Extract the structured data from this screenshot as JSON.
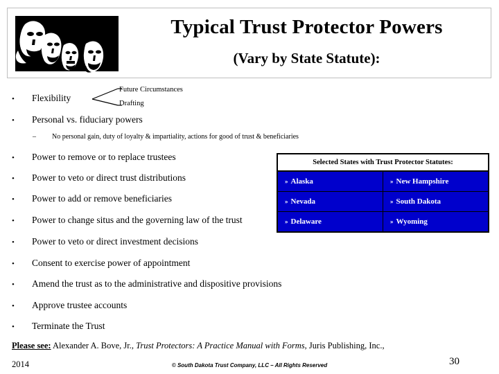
{
  "slide": {
    "title": "Typical Trust Protector Powers",
    "subtitle": "(Vary by State Statute):",
    "header_image_name": "mount-rushmore-graphic"
  },
  "bullets": [
    {
      "marker": "•",
      "text": "Flexibility"
    },
    {
      "marker": "•",
      "text": "Personal vs. fiduciary powers"
    },
    {
      "marker": "•",
      "text": "Power to remove or to replace trustees"
    },
    {
      "marker": "•",
      "text": "Power to veto or direct trust distributions"
    },
    {
      "marker": "•",
      "text": "Power to add or remove beneficiaries"
    },
    {
      "marker": "•",
      "text": "Power to change situs and the governing law of the trust"
    },
    {
      "marker": "•",
      "text": "Power to veto or direct investment decisions"
    },
    {
      "marker": "•",
      "text": "Consent to exercise power of appointment"
    },
    {
      "marker": "•",
      "text": "Amend the trust as to the administrative and dispositive provisions"
    },
    {
      "marker": "•",
      "text": "Approve trustee accounts"
    },
    {
      "marker": "•",
      "text": "Terminate the Trust"
    }
  ],
  "sub_bullet": {
    "marker": "–",
    "text": "No personal gain, duty of loyalty & impartiality, actions for good of trust & beneficiaries"
  },
  "flexibility_branches": {
    "top": "Future Circumstances",
    "bottom": "Drafting"
  },
  "states_table": {
    "header": "Selected States with Trust Protector Statutes:",
    "bullet_glyph": "»",
    "rows": [
      [
        "Alaska",
        "New Hampshire"
      ],
      [
        "Nevada",
        "South Dakota"
      ],
      [
        "Delaware",
        "Wyoming"
      ]
    ]
  },
  "footer": {
    "please_see": "Please see:",
    "citation_pre": " Alexander A. Bove, Jr., ",
    "citation_italic": "Trust Protectors: A Practice Manual with Forms",
    "citation_post": ", Juris Publishing, Inc.,",
    "year": "2014",
    "copyright": "© South Dakota Trust Company, LLC – All Rights Reserved",
    "page_number": "30"
  },
  "colors": {
    "table_blue": "#0000cc",
    "table_border": "#000000",
    "header_border": "#bfbfbf",
    "text": "#000000"
  }
}
